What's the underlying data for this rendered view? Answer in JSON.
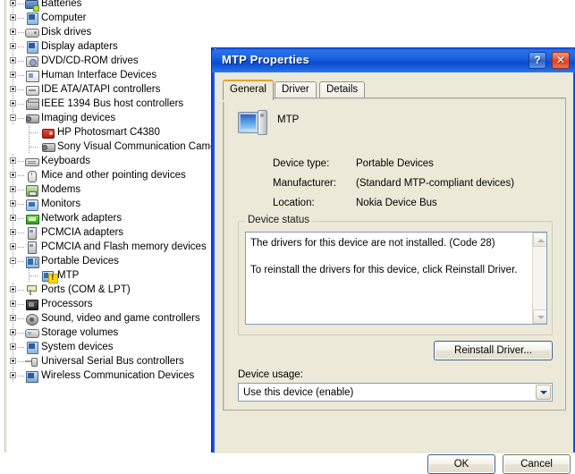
{
  "device_manager": {
    "tree": [
      {
        "label": "Batteries",
        "icon": "battery-icon",
        "expander": "plus",
        "level": 0
      },
      {
        "label": "Computer",
        "icon": "computer-icon",
        "expander": "plus",
        "level": 0
      },
      {
        "label": "Disk drives",
        "icon": "disk-drive-icon",
        "expander": "plus",
        "level": 0
      },
      {
        "label": "Display adapters",
        "icon": "display-adapter-icon",
        "expander": "plus",
        "level": 0
      },
      {
        "label": "DVD/CD-ROM drives",
        "icon": "dvd-drive-icon",
        "expander": "plus",
        "level": 0
      },
      {
        "label": "Human Interface Devices",
        "icon": "hid-icon",
        "expander": "plus",
        "level": 0
      },
      {
        "label": "IDE ATA/ATAPI controllers",
        "icon": "ide-controller-icon",
        "expander": "plus",
        "level": 0
      },
      {
        "label": "IEEE 1394 Bus host controllers",
        "icon": "ieee1394-icon",
        "expander": "plus",
        "level": 0
      },
      {
        "label": "Imaging devices",
        "icon": "camera-icon",
        "expander": "minus",
        "level": 0
      },
      {
        "label": "HP Photosmart C4380",
        "icon": "hp-printer-icon",
        "expander": "none",
        "level": 1
      },
      {
        "label": "Sony Visual Communication Came",
        "icon": "camera-icon",
        "expander": "none",
        "level": 1
      },
      {
        "label": "Keyboards",
        "icon": "keyboard-icon",
        "expander": "plus",
        "level": 0
      },
      {
        "label": "Mice and other pointing devices",
        "icon": "mouse-icon",
        "expander": "plus",
        "level": 0
      },
      {
        "label": "Modems",
        "icon": "modem-icon",
        "expander": "plus",
        "level": 0
      },
      {
        "label": "Monitors",
        "icon": "monitor-icon",
        "expander": "plus",
        "level": 0
      },
      {
        "label": "Network adapters",
        "icon": "network-adapter-icon",
        "expander": "plus",
        "level": 0
      },
      {
        "label": "PCMCIA adapters",
        "icon": "pcmcia-icon",
        "expander": "plus",
        "level": 0
      },
      {
        "label": "PCMCIA and Flash memory devices",
        "icon": "pcmcia-icon",
        "expander": "plus",
        "level": 0
      },
      {
        "label": "Portable Devices",
        "icon": "portable-device-icon",
        "expander": "minus",
        "level": 0
      },
      {
        "label": "MTP",
        "icon": "mtp-warning-icon",
        "expander": "none",
        "level": 1
      },
      {
        "label": "Ports (COM & LPT)",
        "icon": "ports-icon",
        "expander": "plus",
        "level": 0
      },
      {
        "label": "Processors",
        "icon": "processor-icon",
        "expander": "plus",
        "level": 0
      },
      {
        "label": "Sound, video and game controllers",
        "icon": "sound-icon",
        "expander": "plus",
        "level": 0
      },
      {
        "label": "Storage volumes",
        "icon": "storage-volume-icon",
        "expander": "plus",
        "level": 0
      },
      {
        "label": "System devices",
        "icon": "system-device-icon",
        "expander": "plus",
        "level": 0
      },
      {
        "label": "Universal Serial Bus controllers",
        "icon": "usb-icon",
        "expander": "plus",
        "level": 0
      },
      {
        "label": "Wireless Communication Devices",
        "icon": "wireless-icon",
        "expander": "plus",
        "level": 0
      }
    ]
  },
  "dialog": {
    "title": "MTP Properties",
    "help_button": "?",
    "close_button": "✕",
    "tabs": [
      {
        "label": "General",
        "active": true
      },
      {
        "label": "Driver",
        "active": false
      },
      {
        "label": "Details",
        "active": false
      }
    ],
    "device_name": "MTP",
    "properties": [
      {
        "key": "Device type:",
        "value": "Portable Devices"
      },
      {
        "key": "Manufacturer:",
        "value": "(Standard MTP-compliant devices)"
      },
      {
        "key": "Location:",
        "value": "Nokia Device Bus"
      }
    ],
    "device_status": {
      "legend": "Device status",
      "line1": "The drivers for this device are not installed. (Code 28)",
      "line2": "To reinstall the drivers for this device, click Reinstall Driver."
    },
    "reinstall_button": "Reinstall Driver...",
    "device_usage_label": "Device usage:",
    "device_usage_value": "Use this device (enable)",
    "ok_button": "OK",
    "cancel_button": "Cancel"
  },
  "colors": {
    "titlebar_blue": "#1c63e0",
    "dialog_face": "#ece9d8",
    "active_tab_accent": "#e0a32e",
    "close_red": "#d9442a",
    "warning_yellow": "#ffd800"
  }
}
